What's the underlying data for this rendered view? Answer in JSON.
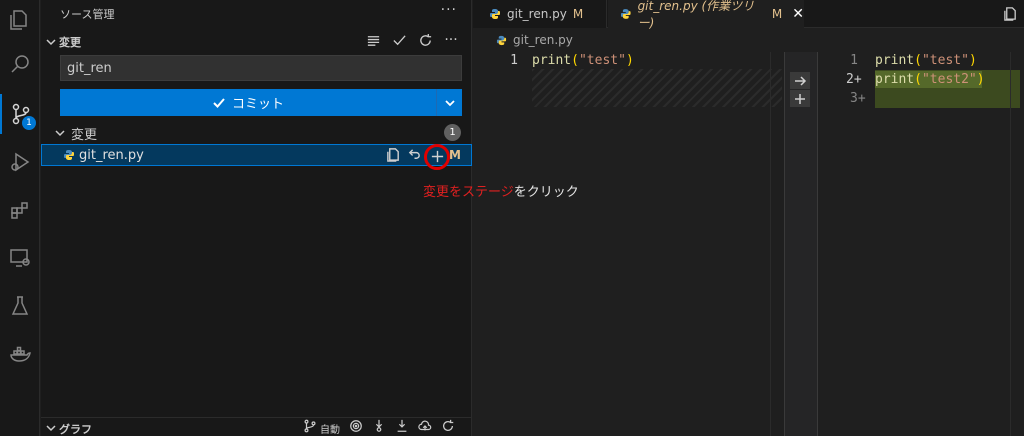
{
  "sidebar": {
    "title": "ソース管理",
    "more": "···",
    "section_title": "変更",
    "commit_message": "git_ren",
    "commit_label": "コミット",
    "changes_label": "変更",
    "changes_count": "1",
    "file": {
      "name": "git_ren.py",
      "status": "M"
    },
    "graph_title": "グラフ",
    "graph_auto": "自動"
  },
  "activity": {
    "badge": "1"
  },
  "annotation": {
    "highlight": "変更をステージ",
    "rest": "をクリック"
  },
  "tabs": [
    {
      "label": "git_ren.py",
      "status": "M"
    },
    {
      "label": "git_ren.py (作業ツリー)",
      "status": "M",
      "close": "✕"
    }
  ],
  "breadcrumb": "git_ren.py",
  "diff": {
    "left": [
      {
        "num": "1",
        "fn": "print",
        "open": "(",
        "str": "\"test\"",
        "close": ")"
      }
    ],
    "right": [
      {
        "num": "1",
        "fn": "print",
        "open": "(",
        "str": "\"test\"",
        "close": ")"
      },
      {
        "num": "2+",
        "fn": "print",
        "open": "(",
        "str": "\"test2\"",
        "close": ")"
      },
      {
        "num": "3+",
        "fn": "",
        "open": "",
        "str": "",
        "close": ""
      }
    ]
  },
  "colors": {
    "accent": "#0078d4",
    "modified": "#e2c08d",
    "annotation_red": "#e02020"
  }
}
